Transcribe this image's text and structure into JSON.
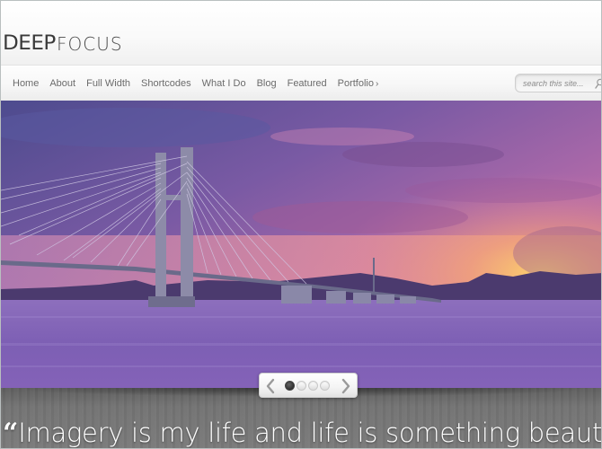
{
  "site": {
    "logo_bold": "DEEP",
    "logo_light": "FOCUS"
  },
  "nav": {
    "items": [
      {
        "label": "Home"
      },
      {
        "label": "About"
      },
      {
        "label": "Full Width"
      },
      {
        "label": "Shortcodes"
      },
      {
        "label": "What I Do"
      },
      {
        "label": "Blog"
      },
      {
        "label": "Featured"
      },
      {
        "label": "Portfolio",
        "has_submenu": true,
        "submenu_indicator": "›"
      }
    ]
  },
  "search": {
    "placeholder": "search this site...",
    "value": "",
    "icon": "search-icon"
  },
  "slider": {
    "image_alt": "Cable-stayed bridge over a river at purple sunset",
    "slide_count": 4,
    "active_slide": 1,
    "prev_icon": "chevron-left-icon",
    "next_icon": "chevron-right-icon"
  },
  "tagline": {
    "quote_mark": "“",
    "text": "Imagery is my life and life is something beautiful"
  },
  "colors": {
    "text_nav": "#6b6b6b",
    "logo": "#3a3a3a",
    "tagline": "#ffffff",
    "bottom_band": "#737373"
  }
}
